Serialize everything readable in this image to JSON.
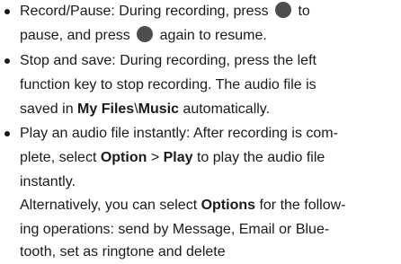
{
  "items": [
    {
      "line1_a": "Record/Pause:  During recording, press",
      "line1_icon": "round-key-icon",
      "line1_b": "to",
      "line2_a": "pause, and press",
      "line2_icon": "round-key-icon",
      "line2_b": "again to resume."
    },
    {
      "line1": "Stop and save: During recording, press the left",
      "line2": "function key to stop recording. The audio file is",
      "line3_a": "saved in ",
      "line3_path1": "My Files",
      "line3_sep": "\\",
      "line3_path2": "Music",
      "line3_b": " automatically."
    },
    {
      "line1": "Play an audio file instantly: After recording is com-",
      "line2_a": "plete, select ",
      "line2_opt": "Option",
      "line2_gt": " > ",
      "line2_play": "Play",
      "line2_b": " to play the audio file",
      "line3": "instantly.",
      "line4_a": "Alternatively, you can select ",
      "line4_opts": "Options",
      "line4_b": " for the follow-",
      "line5": "ing operations: send by Message, Email or Blue-",
      "line6": "tooth, set as ringtone and delete"
    }
  ]
}
